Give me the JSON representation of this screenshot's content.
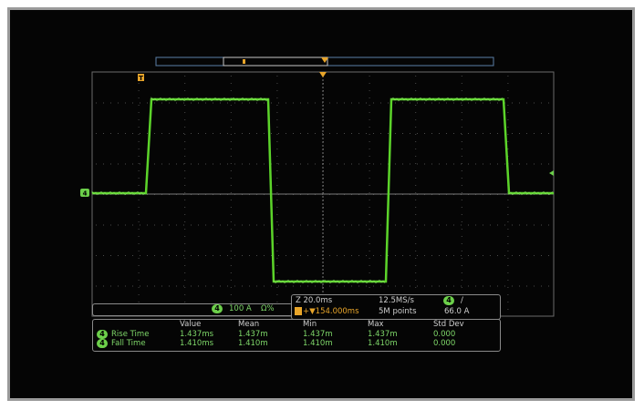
{
  "channel": {
    "id": "4",
    "scale": "100 A",
    "coupling": "Ω%"
  },
  "timebase": {
    "horizontal_scale": "Z 20.0ms",
    "sample_rate": "12.5MS/s",
    "trigger_delay": "+▼154.000ms",
    "record_length": "5M points",
    "trigger_channel": "4",
    "trigger_slope": "/",
    "trigger_level": "66.0 A"
  },
  "trigger_marker": "T",
  "measurements": {
    "columns": [
      "Value",
      "Mean",
      "Min",
      "Max",
      "Std Dev"
    ],
    "rows": [
      {
        "channel": "4",
        "name": "Rise Time",
        "value": "1.437ms",
        "mean": "1.437m",
        "min": "1.437m",
        "max": "1.437m",
        "std_dev": "0.000"
      },
      {
        "channel": "4",
        "name": "Fall Time",
        "value": "1.410ms",
        "mean": "1.410m",
        "min": "1.410m",
        "max": "1.410m",
        "std_dev": "0.000"
      }
    ]
  },
  "colors": {
    "trace": "#5cd42a",
    "accent_orange": "#e8a52a",
    "grid": "#5a5a5a"
  }
}
